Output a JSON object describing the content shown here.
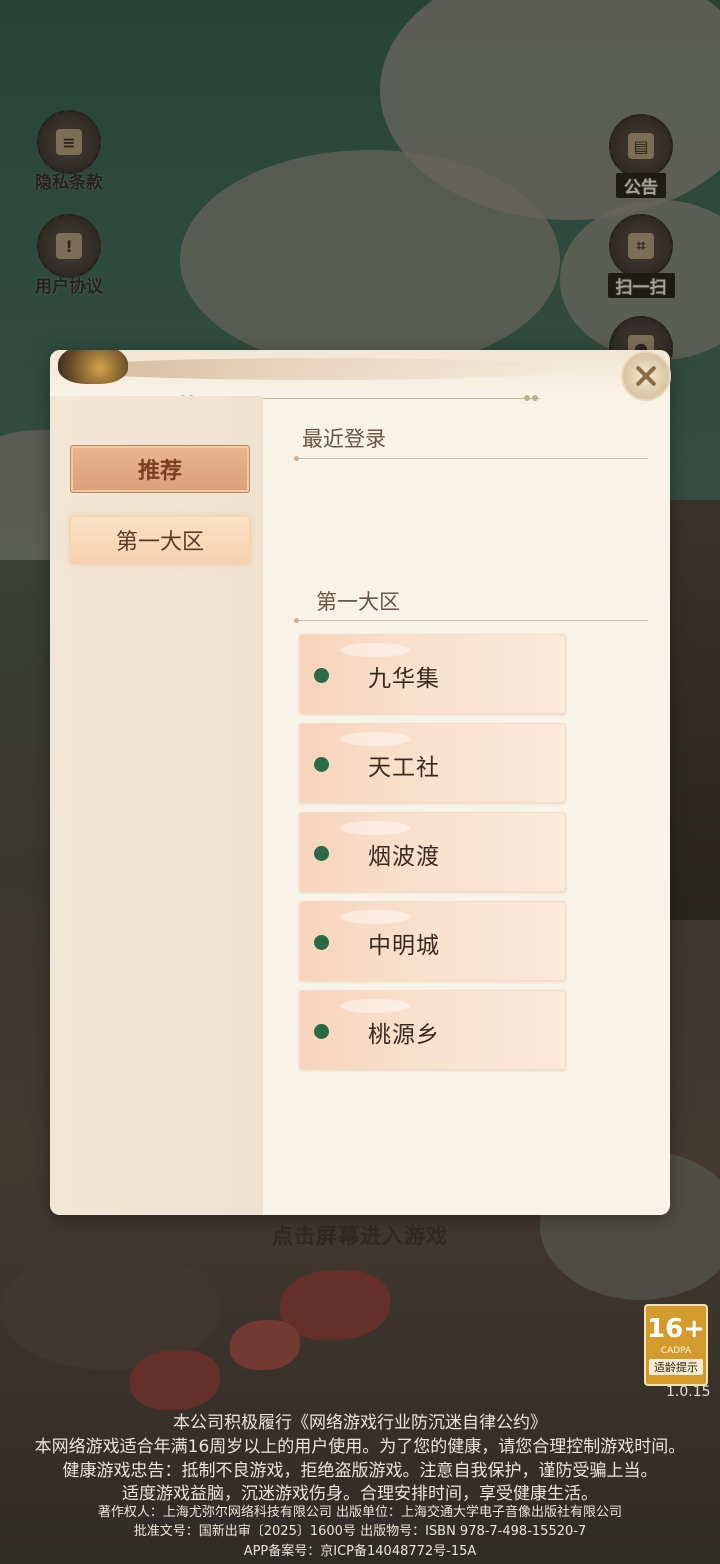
{
  "side_left": [
    {
      "label": "隐私条款",
      "icon": "scroll-icon"
    },
    {
      "label": "用户协议",
      "icon": "alert-scroll-icon"
    }
  ],
  "side_right": [
    {
      "label": "公告",
      "icon": "notice-icon"
    },
    {
      "label": "扫一扫",
      "icon": "scan-icon"
    }
  ],
  "server_dialog": {
    "tabs": [
      {
        "label": "推荐",
        "active": true
      },
      {
        "label": "第一大区",
        "active": false
      }
    ],
    "recent_title": "最近登录",
    "region_title": "第一大区",
    "servers": [
      {
        "name": "九华集",
        "status_color": "#2c6a45"
      },
      {
        "name": "天工社",
        "status_color": "#2c6a45"
      },
      {
        "name": "烟波渡",
        "status_color": "#2c6a45"
      },
      {
        "name": "中明城",
        "status_color": "#2c6a45"
      },
      {
        "name": "桃源乡",
        "status_color": "#2c6a45"
      }
    ],
    "close_icon": "close-icon"
  },
  "tap_prompt": "点击屏幕进入游戏",
  "age_rating": {
    "value": "16+",
    "org": "CADPA",
    "tip": "适龄提示"
  },
  "version": "1.0.15",
  "legal": {
    "line1": "本公司积极履行《网络游戏行业防沉迷自律公约》",
    "line2": "本网络游戏适合年满16周岁以上的用户使用。为了您的健康，请您合理控制游戏时间。",
    "line3": "健康游戏忠告：抵制不良游戏，拒绝盗版游戏。注意自我保护，谨防受骗上当。",
    "line4": "适度游戏益脑，沉迷游戏伤身。合理安排时间，享受健康生活。",
    "line5": "著作权人：上海尤弥尔网络科技有限公司   出版单位：上海交通大学电子音像出版社有限公司",
    "line6": "批准文号：国新出审〔2025〕1600号   出版物号：ISBN 978-7-498-15520-7",
    "line7": "APP备案号：京ICP备14048772号-15A"
  }
}
